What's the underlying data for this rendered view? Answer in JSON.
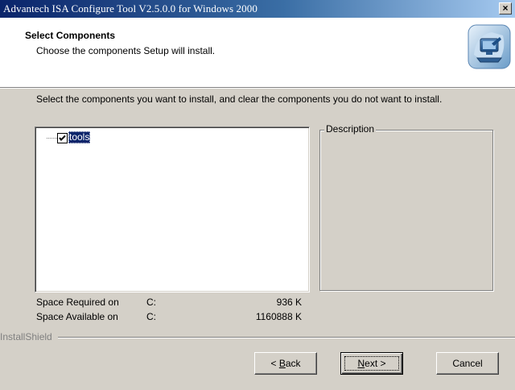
{
  "window": {
    "title": "Advantech ISA Configure Tool V2.5.0.0 for Windows 2000",
    "close_label": "×"
  },
  "header": {
    "title": "Select Components",
    "subtitle": "Choose the components Setup will install.",
    "icon": "installer-computer-icon"
  },
  "instruction": "Select the components you want to install, and clear the components you do not want to install.",
  "components": [
    {
      "label": "tools",
      "checked": true,
      "selected": true
    }
  ],
  "description": {
    "legend": "Description",
    "text": ""
  },
  "space": {
    "required": {
      "label": "Space Required on",
      "drive": "C:",
      "value": "936 K"
    },
    "available": {
      "label": "Space Available on",
      "drive": "C:",
      "value": "1160888 K"
    }
  },
  "branding": "InstallShield",
  "buttons": {
    "back": {
      "prefix": "< ",
      "mnemonic": "B",
      "rest": "ack"
    },
    "next": {
      "mnemonic": "N",
      "rest": "ext >"
    },
    "cancel": "Cancel"
  },
  "colors": {
    "titlebar_start": "#0a246a",
    "titlebar_end": "#a6caf0",
    "dialog_face": "#d4d0c8",
    "selection": "#0a246a"
  }
}
